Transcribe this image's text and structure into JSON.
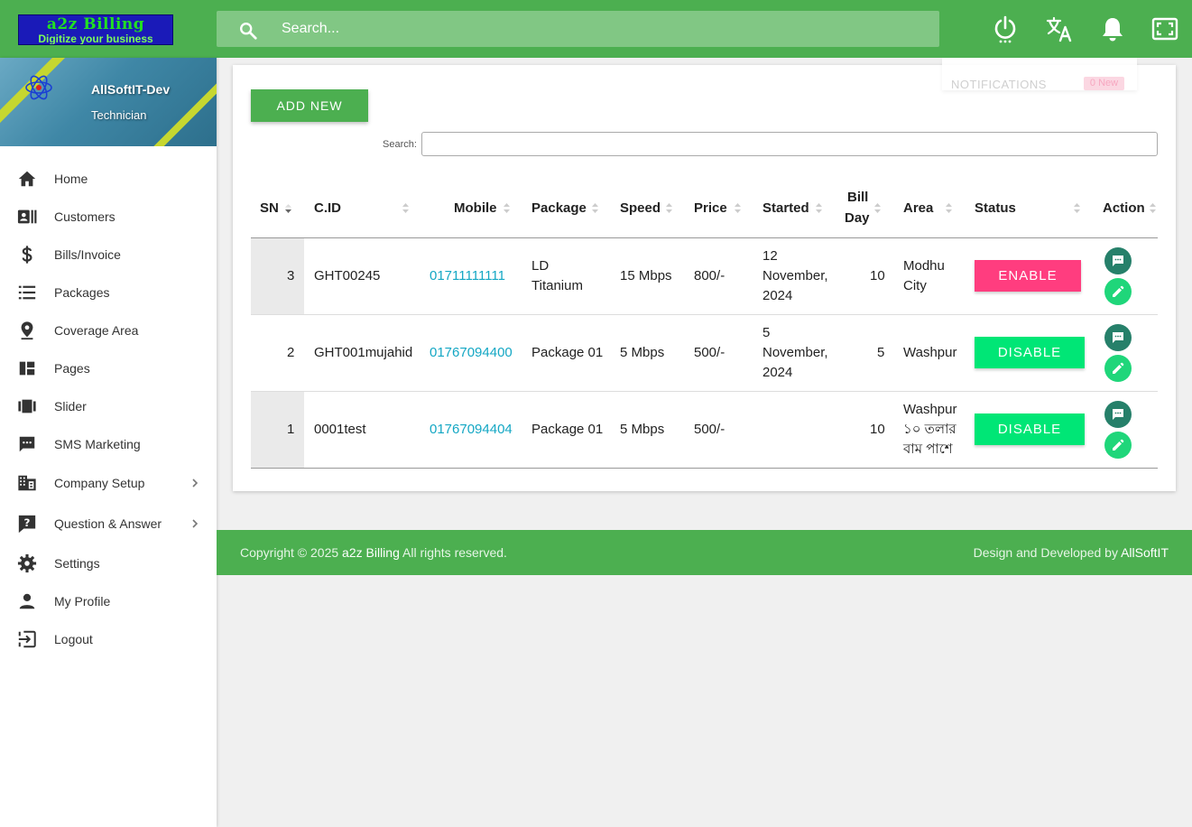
{
  "header": {
    "logo_line1": "a2z Billing",
    "logo_line2": "Digitize your business",
    "search_placeholder": "Search...",
    "icons": [
      "power-icon",
      "translate-icon",
      "bell-icon",
      "fullscreen-icon"
    ]
  },
  "notifications": {
    "title": "NOTIFICATIONS",
    "badge": "0 New"
  },
  "user": {
    "name": "AllSoftIT-Dev",
    "role": "Technician"
  },
  "nav": [
    {
      "label": "Home",
      "icon": "home-icon"
    },
    {
      "label": "Customers",
      "icon": "customers-icon"
    },
    {
      "label": "Bills/Invoice",
      "icon": "dollar-icon"
    },
    {
      "label": "Packages",
      "icon": "list-icon"
    },
    {
      "label": "Coverage Area",
      "icon": "location-pin-icon"
    },
    {
      "label": "Pages",
      "icon": "dashboard-icon"
    },
    {
      "label": "Slider",
      "icon": "slider-icon"
    },
    {
      "label": "SMS Marketing",
      "icon": "sms-icon"
    },
    {
      "label": "Company Setup",
      "icon": "building-icon"
    },
    {
      "label": "Question & Answer",
      "icon": "help-icon"
    },
    {
      "label": "Settings",
      "icon": "gear-icon"
    },
    {
      "label": "My Profile",
      "icon": "person-icon"
    },
    {
      "label": "Logout",
      "icon": "logout-icon"
    }
  ],
  "toolbar": {
    "add_label": "ADD NEW",
    "search_label": "Search:"
  },
  "table": {
    "headers": {
      "sn": "SN",
      "cid": "C.ID",
      "mobile": "Mobile",
      "package": "Package",
      "speed": "Speed",
      "price": "Price",
      "started": "Started",
      "billday_1": "Bill",
      "billday_2": "Day",
      "area": "Area",
      "status": "Status",
      "action": "Action"
    },
    "rows": [
      {
        "sn": "3",
        "cid": "GHT00245",
        "mobile": "01711111111",
        "package_1": "LD",
        "package_2": "Titanium",
        "speed": "15 Mbps",
        "price": "800/-",
        "started_1": "12",
        "started_2": "November,",
        "started_3": "2024",
        "billday": "10",
        "area_1": "Modhu",
        "area_2": "City",
        "area_3": "",
        "status": "ENABLE",
        "status_color": "#ff3d7f"
      },
      {
        "sn": "2",
        "cid": "GHT001mujahid",
        "mobile": "01767094400",
        "package_1": "Package 01",
        "package_2": "",
        "speed": "5 Mbps",
        "price": "500/-",
        "started_1": "5",
        "started_2": "November,",
        "started_3": "2024",
        "billday": "5",
        "area_1": "Washpur",
        "area_2": "",
        "area_3": "",
        "status": "DISABLE",
        "status_color": "#00e676"
      },
      {
        "sn": "1",
        "cid": "0001test",
        "mobile": "01767094404",
        "package_1": "Package 01",
        "package_2": "",
        "speed": "5 Mbps",
        "price": "500/-",
        "started_1": "",
        "started_2": "",
        "started_3": "",
        "billday": "10",
        "area_1": "Washpur",
        "area_2": "১০ তলার",
        "area_3": "বাম পাশে",
        "status": "DISABLE",
        "status_color": "#00e676"
      }
    ]
  },
  "footer": {
    "copyright_prefix": "Copyright © 2025 ",
    "brand": "a2z Billing",
    "rights": " All rights reserved.",
    "design_prefix": "Design and Developed by ",
    "developer": "AllSoftIT"
  },
  "colors": {
    "primary": "#4caf50",
    "search_bg": "#81c784",
    "link": "#14a7c4",
    "enable": "#ff3d7f",
    "disable": "#00e676",
    "action_message": "#26806a",
    "action_edit": "#1fd67a"
  }
}
